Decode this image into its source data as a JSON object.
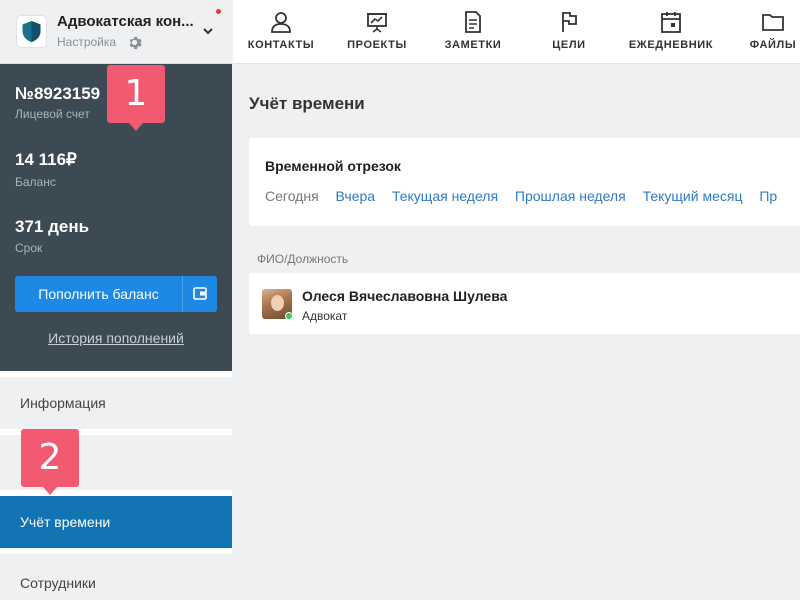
{
  "org": {
    "name": "Адвокатская кон...",
    "subtitle": "Настройка"
  },
  "account": {
    "number": "№8923159",
    "number_label": "Лицевой счет",
    "balance": "14 116₽",
    "balance_label": "Баланс",
    "term": "371 день",
    "term_label": "Срок",
    "topup_label": "Пополнить баланс",
    "history_label": "История пополнений"
  },
  "sidebar": {
    "items": [
      {
        "label": "Информация"
      },
      {
        "label": ""
      },
      {
        "label": "Учёт времени"
      },
      {
        "label": "Сотрудники"
      }
    ]
  },
  "callouts": [
    "1",
    "2"
  ],
  "topnav": {
    "items": [
      {
        "label": "КОНТАКТЫ",
        "icon": "user-icon"
      },
      {
        "label": "ПРОЕКТЫ",
        "icon": "presentation-icon"
      },
      {
        "label": "ЗАМЕТКИ",
        "icon": "document-icon"
      },
      {
        "label": "ЦЕЛИ",
        "icon": "flag-icon"
      },
      {
        "label": "ЕЖЕДНЕВНИК",
        "icon": "calendar-icon"
      },
      {
        "label": "ФАЙЛЫ",
        "icon": "folder-icon"
      }
    ]
  },
  "main": {
    "title": "Учёт времени",
    "period": {
      "title": "Временной отрезок",
      "options": [
        "Сегодня",
        "Вчера",
        "Текущая неделя",
        "Прошлая неделя",
        "Текущий месяц",
        "Пр"
      ],
      "selected": "Сегодня"
    },
    "list_header": "ФИО/Должность",
    "employees": [
      {
        "name": "Олеся Вячеславовна Шулева",
        "role": "Адвокат",
        "status": "online"
      }
    ]
  },
  "colors": {
    "accent": "#1374b4",
    "button": "#1e88e5",
    "account_bg": "#3b4a53",
    "callout": "#f25a72",
    "link": "#2f7ac8",
    "online": "#3ec55d",
    "notification": "#e53935"
  }
}
